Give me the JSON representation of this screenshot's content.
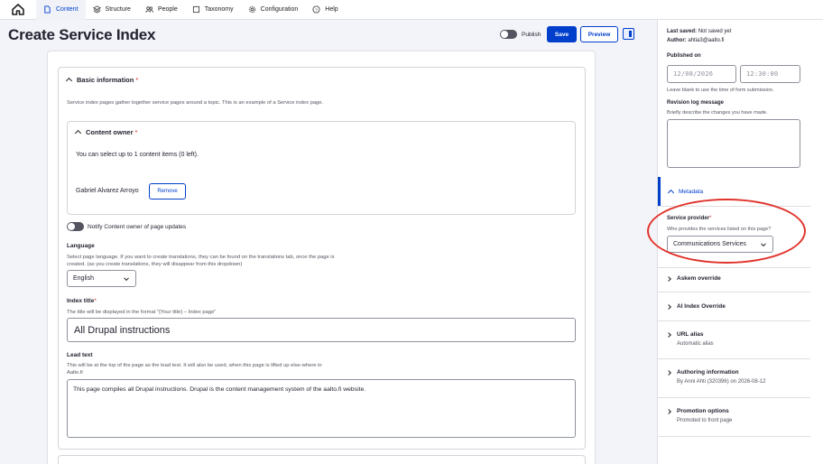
{
  "toolbar": {
    "home_icon": "home-icon",
    "items": [
      {
        "label": "Content",
        "icon": "document-icon",
        "active": true
      },
      {
        "label": "Structure",
        "icon": "layers-icon"
      },
      {
        "label": "People",
        "icon": "people-icon"
      },
      {
        "label": "Taxonomy",
        "icon": "checkbox-icon"
      },
      {
        "label": "Configuration",
        "icon": "gear-icon"
      },
      {
        "label": "Help",
        "icon": "help-icon"
      }
    ]
  },
  "header": {
    "title": "Create Service Index",
    "publish_label": "Publish",
    "save_label": "Save",
    "preview_label": "Preview"
  },
  "form": {
    "basic_info": {
      "title": "Basic information",
      "required": "*",
      "description": "Service index pages gather together service pages around a topic. This is an example of a Service index page."
    },
    "content_owner": {
      "title": "Content owner",
      "required": "*",
      "limit_text": "You can select up to 1 content items (0 left).",
      "owner_name": "Gabriel Alvarez Arroyo",
      "remove_label": "Remove"
    },
    "notify_label": "Notify Content owner of page updates",
    "language": {
      "label": "Language",
      "description": "Select page language. If you want to create translations, they can be found on the translations tab, once the page is created. (as you create translations, they will disappear from this dropdown)",
      "value": "English"
    },
    "index_title": {
      "label": "Index title",
      "required": "*",
      "description": "The title will be displayed in the format \"{Your title} – Index page\"",
      "value": "All Drupal instructions"
    },
    "lead_text": {
      "label": "Lead text",
      "description": "This will be at the top of the page as the lead text. It will also be used, when this page is lifted up else-where in Aalto.fi",
      "value": "This page compiles all Drupal instructions. Drupal is the content management system of the aalto.fi website."
    }
  },
  "sidebar": {
    "last_saved_label": "Last saved:",
    "last_saved_value": "Not saved yet",
    "author_label": "Author:",
    "author_value": "ahtia3@aalto.fi",
    "published_on_label": "Published on",
    "date_value": "12/08/2026",
    "time_value": "12:30:00",
    "published_hint": "Leave blank to use the time of form submission.",
    "revision_label": "Revision log message",
    "revision_hint": "Briefly describe the changes you have made.",
    "metadata_label": "Metadata",
    "service_provider": {
      "label": "Service provider",
      "required": "*",
      "description": "Who provides the services listed on this page?",
      "value": "Communications Services"
    },
    "sections": [
      {
        "title": "Askem override",
        "subtitle": ""
      },
      {
        "title": "AI Index Override",
        "subtitle": ""
      },
      {
        "title": "URL alias",
        "subtitle": "Automatic alias"
      },
      {
        "title": "Authoring information",
        "subtitle": "By Anni Ahti (320396) on 2026-08-12"
      },
      {
        "title": "Promotion options",
        "subtitle": "Promoted to front page"
      }
    ]
  },
  "colors": {
    "accent": "#003ecc",
    "annotation": "#e0332b",
    "required": "#dc2323"
  }
}
